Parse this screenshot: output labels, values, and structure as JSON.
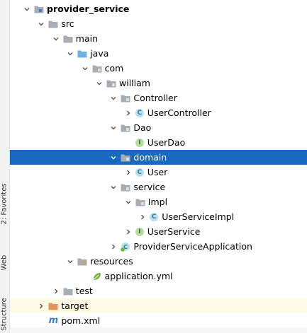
{
  "sidebar": {
    "tabs": [
      {
        "label": "2: Favorites"
      },
      {
        "label": "Web"
      },
      {
        "label": "Structure"
      }
    ]
  },
  "tree": {
    "colors": {
      "selection": "#1a69c0",
      "highlight": "#fdfbe4",
      "folder": "#a8adb3",
      "source_folder": "#6fb1e5",
      "excluded_folder": "#e5925c"
    },
    "nodes": [
      {
        "label": "provider_service",
        "arrow": "expanded",
        "icon": "module-folder"
      },
      {
        "label": "src",
        "arrow": "expanded",
        "icon": "folder"
      },
      {
        "label": "main",
        "arrow": "expanded",
        "icon": "folder"
      },
      {
        "label": "java",
        "arrow": "expanded",
        "icon": "source-folder"
      },
      {
        "label": "com",
        "arrow": "expanded",
        "icon": "package"
      },
      {
        "label": "william",
        "arrow": "expanded",
        "icon": "package"
      },
      {
        "label": "Controller",
        "arrow": "expanded",
        "icon": "package"
      },
      {
        "label": "UserController",
        "arrow": "collapsed",
        "icon": "class"
      },
      {
        "label": "Dao",
        "arrow": "expanded",
        "icon": "package"
      },
      {
        "label": "UserDao",
        "arrow": "none",
        "icon": "interface"
      },
      {
        "label": "domain",
        "arrow": "expanded",
        "icon": "package"
      },
      {
        "label": "User",
        "arrow": "collapsed",
        "icon": "class"
      },
      {
        "label": "service",
        "arrow": "expanded",
        "icon": "package"
      },
      {
        "label": "Impl",
        "arrow": "expanded",
        "icon": "package"
      },
      {
        "label": "UserServiceImpl",
        "arrow": "collapsed",
        "icon": "class"
      },
      {
        "label": "UserService",
        "arrow": "collapsed",
        "icon": "interface"
      },
      {
        "label": "ProviderServiceApplication",
        "arrow": "collapsed",
        "icon": "spring-boot-class"
      },
      {
        "label": "resources",
        "arrow": "expanded",
        "icon": "resources-folder"
      },
      {
        "label": "application.yml",
        "arrow": "none",
        "icon": "spring-yml"
      },
      {
        "label": "test",
        "arrow": "collapsed",
        "icon": "folder"
      },
      {
        "label": "target",
        "arrow": "collapsed",
        "icon": "excluded-folder"
      },
      {
        "label": "pom.xml",
        "arrow": "none",
        "icon": "maven"
      }
    ]
  }
}
